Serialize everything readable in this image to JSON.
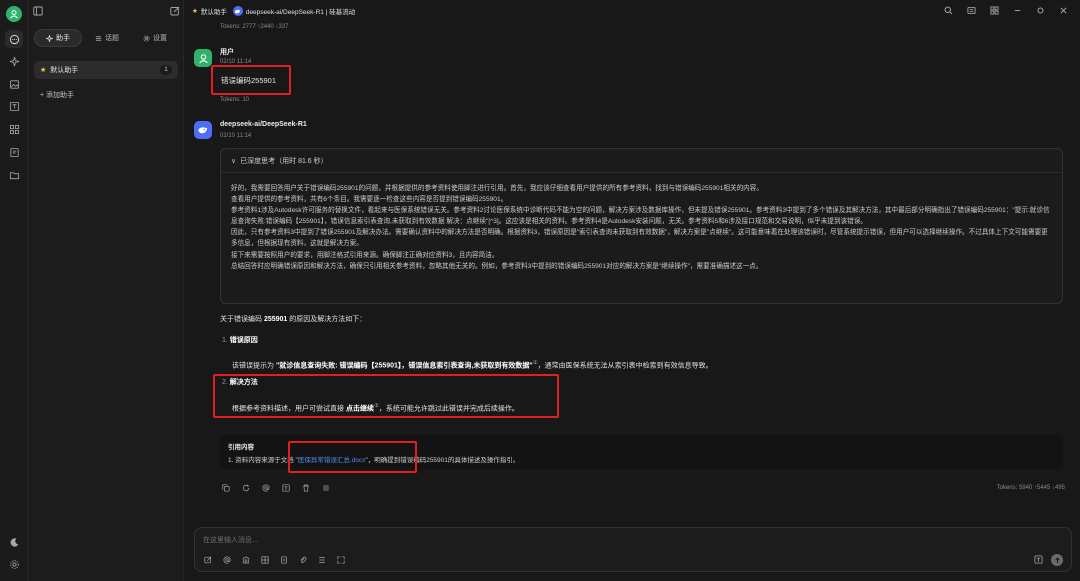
{
  "colors": {
    "accent_green": "#2fb36b",
    "red_annotation": "#e02020",
    "link_blue": "#4e8ff0",
    "deepseek_blue": "#4f6ef7"
  },
  "sidebar": {
    "tabs": [
      {
        "label": "助手",
        "icon": "sparkle-icon"
      },
      {
        "label": "话题",
        "icon": "list-icon"
      },
      {
        "label": "设置",
        "icon": "gear-icon"
      }
    ],
    "assistant_item": {
      "label": "默认助手",
      "icon": "star-icon",
      "count": "1"
    },
    "add_assistant_label": "+ 添加助手"
  },
  "header": {
    "assistant_tab": "默认助手",
    "model_tab": "deepseek-ai/DeepSeek-R1 | 硅基流动"
  },
  "chat": {
    "top_tokens": "Tokens: 2777 ↑2440 ↓337",
    "user_message": {
      "name": "用户",
      "time": "02/10 11:14",
      "text": "错误编码255901",
      "tokens": "Tokens: 10"
    },
    "assistant_message": {
      "name": "deepseek-ai/DeepSeek-R1",
      "time": "02/10 11:14",
      "think_header": "已深度思考（用时 81.6 秒）",
      "think_lines": [
        "好的，我需要回答用户关于错误编码255901的问题，并根据提供的参考资料使用脚注进行引用。首先，我应该仔细查看用户提供的所有参考资料，找到与错误编码255901相关的内容。",
        "查看用户提供的参考资料，共有6个条目。我需要逐一检查这些内容是否提到错误编码255901。",
        "参考资料1涉及Autodesk许可服务的替换文件，看起来与医保系统错误无关。参考资料2讨论医保系统中诊断代码不能为空的问题，解决方案涉及数据库操作，但未提及错误255901。参考资料3中提到了多个错误及其解决方法，其中最后部分明确指出了错误编码255901：\"提示:就诊信息查询失败:错误编码【255901】，错误信息索引表查询,未获取到有效数据 解决：点继续\"[^3]。这应该是相关的资料。参考资料4是Autodesk安装问题，无关。参考资料5和6涉及接口规范和交易说明，似乎未提到该错误。",
        "因此，只有参考资料3中提到了错误255901及解决办法。需要确认资料中的解决方法是否明确。根据资料3，错误原因是\"索引表查询未获取到有效数据\"，解决方案是\"点继续\"。这可能意味着在处理该错误时，尽管系统提示错误，但用户可以选择继续操作。不过具体上下文可能需要更多信息，但根据现有资料，这就是解决方案。",
        "接下来需要按照用户的要求，用脚注格式引用来源。确保脚注正确对应资料3，且内容简洁。",
        "总结回答时应明确错误原因和解决方法，确保只引用相关参考资料，忽略其他无关的。例如，参考资料3中提到的错误编码255901对应的解决方案是\"继续操作\"，需要准确描述这一点。"
      ],
      "answer_intro_pre": "关于错误编码 ",
      "answer_intro_code": "255901",
      "answer_intro_post": " 的原因及解决方法如下：",
      "item1_num": "1.",
      "item1_title": "错误原因",
      "item1_pre": "该错误提示为 ",
      "item1_bold": "\"就诊信息查询失败: 错误编码【255901】，错误信息索引表查询,未获取到有效数据\"",
      "item1_fn": "①",
      "item1_post": "，通常由医保系统无法从索引表中检索到有效信息导致。",
      "item2_num": "2.",
      "item2_title": "解决方法",
      "item2_pre": "根据参考资料描述，用户可尝试直接 ",
      "item2_bold": "点击继续",
      "item2_fn": "①",
      "item2_post": "，系统可能允许跳过此错误并完成后续操作。",
      "cite_title": "引用内容",
      "cite_pre": "1. 资料内容来源于文档 \"",
      "cite_link": "医保异常错误汇总.docx",
      "cite_post": "\"，明确提到错误编码255901的具体描述及操作指引。",
      "tokens": "Tokens: 5940 ↑5445 ↓495"
    }
  },
  "input": {
    "placeholder": "在这里输入消息..."
  }
}
